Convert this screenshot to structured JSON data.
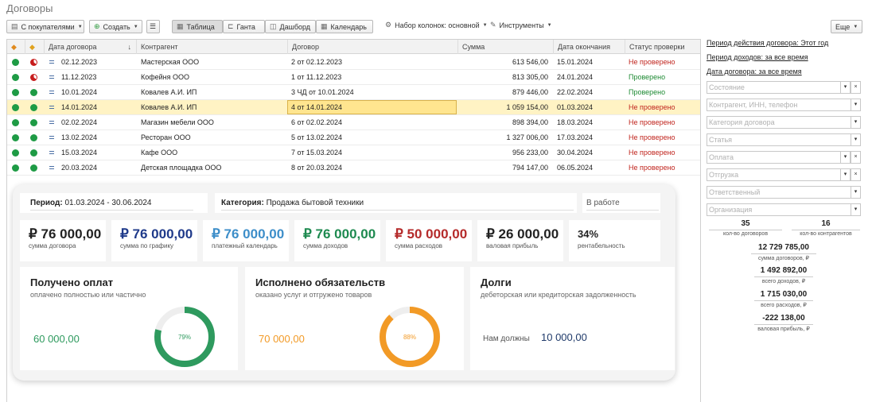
{
  "title": "Договоры",
  "toolbar": {
    "customers": "С покупателями",
    "create": "Создать",
    "table": "Таблица",
    "gantt": "Ганта",
    "dashboard": "Дашборд",
    "calendar": "Календарь",
    "columns": "Набор колонок: основной",
    "tools": "Инструменты",
    "more": "Еще"
  },
  "columns": {
    "date": "Дата договора",
    "sort": "↓",
    "partner": "Контрагент",
    "contract": "Договор",
    "sum": "Сумма",
    "end": "Дата окончания",
    "status": "Статус проверки"
  },
  "rows": [
    {
      "date": "02.12.2023",
      "partner": "Мастерская ООО",
      "contract": "2 от 02.12.2023",
      "sum": "613 546,00",
      "end": "15.01.2024",
      "status": "Не проверено"
    },
    {
      "date": "11.12.2023",
      "partner": "Кофейня ООО",
      "contract": "1 от 11.12.2023",
      "sum": "813 305,00",
      "end": "24.01.2024",
      "status": "Проверено"
    },
    {
      "date": "10.01.2024",
      "partner": "Ковалев А.И. ИП",
      "contract": "3 ЧД от 10.01.2024",
      "sum": "879 446,00",
      "end": "22.02.2024",
      "status": "Проверено"
    },
    {
      "date": "14.01.2024",
      "partner": "Ковалев А.И. ИП",
      "contract": "4 от 14.01.2024",
      "sum": "1 059 154,00",
      "end": "01.03.2024",
      "status": "Не проверено"
    },
    {
      "date": "02.02.2024",
      "partner": "Магазин мебели ООО",
      "contract": "6 от 02.02.2024",
      "sum": "898 394,00",
      "end": "18.03.2024",
      "status": "Не проверено"
    },
    {
      "date": "13.02.2024",
      "partner": "Ресторан ООО",
      "contract": "5 от 13.02.2024",
      "sum": "1 327 006,00",
      "end": "17.03.2024",
      "status": "Не проверено"
    },
    {
      "date": "15.03.2024",
      "partner": "Кафе ООО",
      "contract": "7 от 15.03.2024",
      "sum": "956 233,00",
      "end": "30.04.2024",
      "status": "Не проверено"
    },
    {
      "date": "20.03.2024",
      "partner": "Детская площадка ООО",
      "contract": "8 от 20.03.2024",
      "sum": "794 147,00",
      "end": "06.05.2024",
      "status": "Не проверено"
    }
  ],
  "dashboard": {
    "period_label": "Период:",
    "period_value": "01.03.2024 - 30.06.2024",
    "category_label": "Категория:",
    "category_value": "Продажа бытовой техники",
    "state": "В работе",
    "kpis": [
      {
        "value": "₽ 76 000,00",
        "label": "сумма договора",
        "color": "#222222"
      },
      {
        "value": "₽ 76 000,00",
        "label": "сумма по графику",
        "color": "#1f3a8a"
      },
      {
        "value": "₽ 76 000,00",
        "label": "платежный календарь",
        "color": "#3d8ec9"
      },
      {
        "value": "₽ 76 000,00",
        "label": "сумма доходов",
        "color": "#1e8a50"
      },
      {
        "value": "₽ 50 000,00",
        "label": "сумма расходов",
        "color": "#b52b2b"
      },
      {
        "value": "₽ 26 000,00",
        "label": "валовая прибыль",
        "color": "#222222"
      },
      {
        "value": "34%",
        "label": "рентабельность",
        "color": "#222222"
      }
    ],
    "paid": {
      "title": "Получено оплат",
      "subtitle": "оплачено полностью или частично",
      "amount": "60 000,00",
      "percent": 79,
      "percent_label": "79%",
      "color": "#2e9a5e"
    },
    "done": {
      "title": "Исполнено обязательств",
      "subtitle": "оказано услуг и отгружено товаров",
      "amount": "70 000,00",
      "percent": 88,
      "percent_label": "88%",
      "color": "#f29a26"
    },
    "debts": {
      "title": "Долги",
      "subtitle": "дебеторская или кредиторская задолженность",
      "label": "Нам должны",
      "amount": "10 000,00"
    }
  },
  "sidebar": {
    "links": [
      "Период действия договора: Этот год",
      "Период доходов: за все время",
      "Дата договора: за все время"
    ],
    "filters": [
      {
        "placeholder": "Состояние",
        "clear": true
      },
      {
        "placeholder": "Контрагент, ИНН, телефон",
        "clear": false
      },
      {
        "placeholder": "Категория договора",
        "clear": false
      },
      {
        "placeholder": "Статья",
        "clear": false
      },
      {
        "placeholder": "Оплата",
        "clear": true
      },
      {
        "placeholder": "Отгрузка",
        "clear": true
      },
      {
        "placeholder": "Ответственный",
        "clear": false
      },
      {
        "placeholder": "Организация",
        "clear": false
      }
    ],
    "stats": {
      "contracts_count": "35",
      "contracts_count_label": "кол-во договоров",
      "partners_count": "16",
      "partners_count_label": "кол-во контрагентов",
      "sum": "12 729 785,00",
      "sum_label": "сумма договоров, ₽",
      "income": "1 492 892,00",
      "income_label": "всего доходов, ₽",
      "expense": "1 715 030,00",
      "expense_label": "всего расходов, ₽",
      "profit": "-222 138,00",
      "profit_label": "валовая прибыль, ₽"
    }
  }
}
